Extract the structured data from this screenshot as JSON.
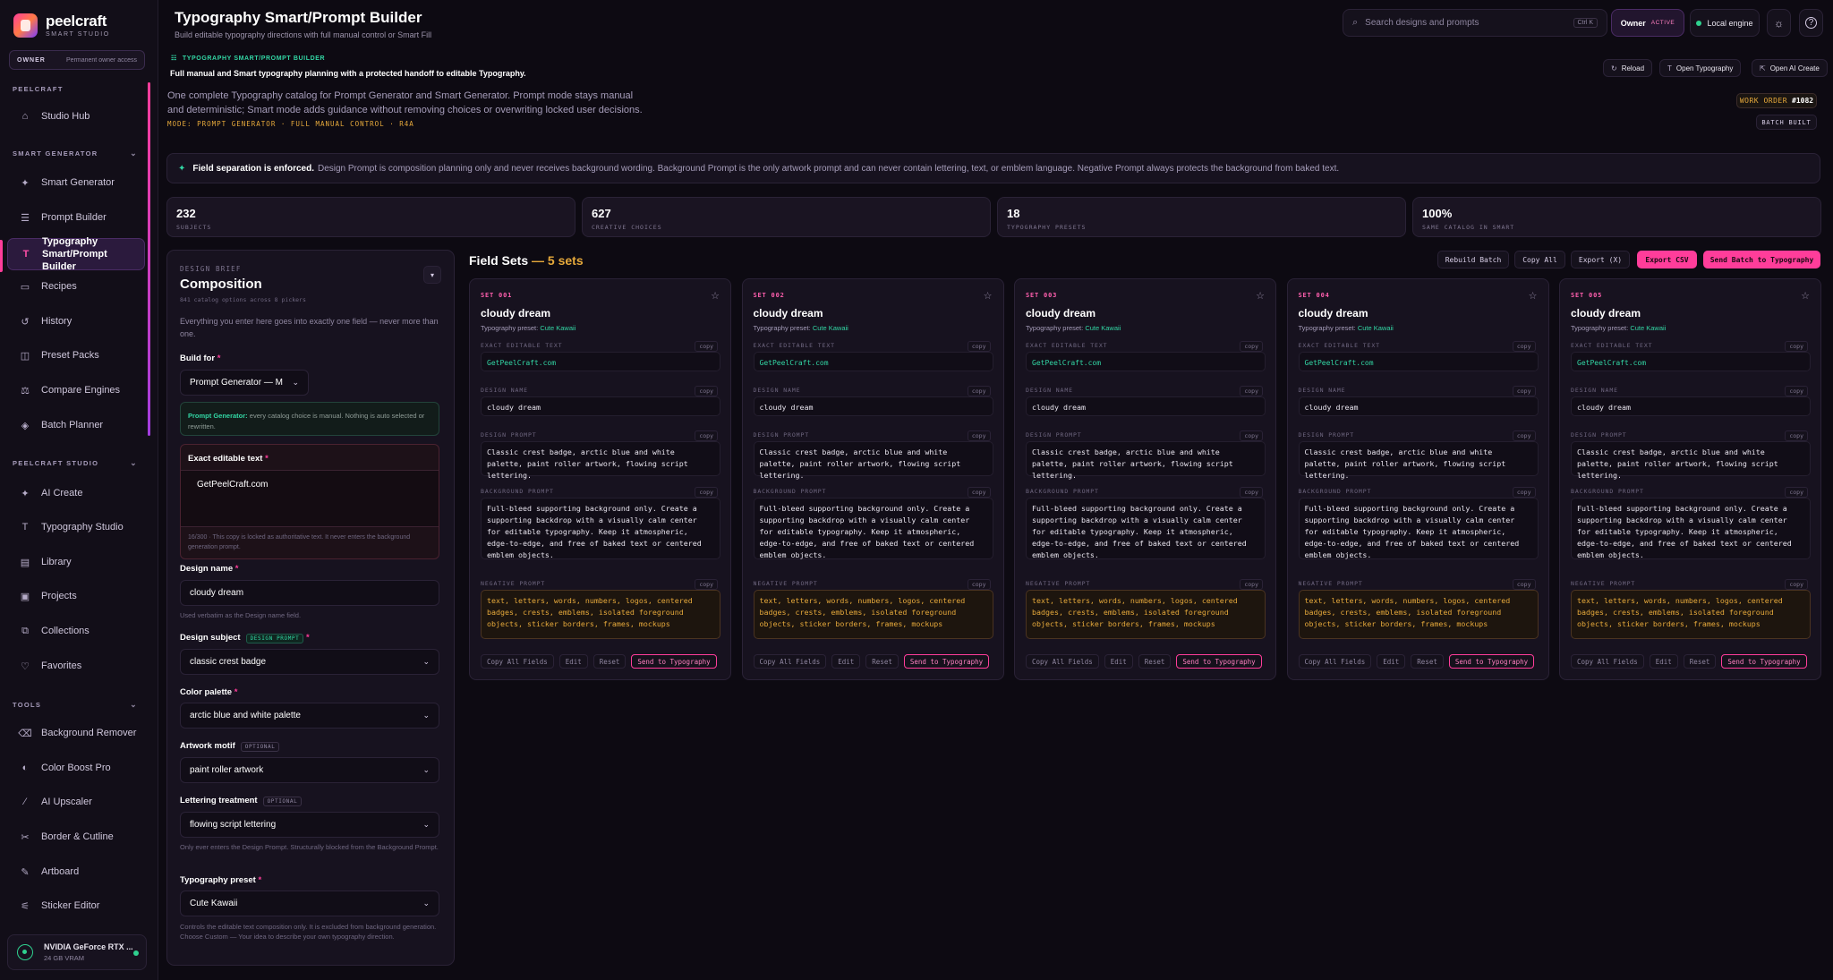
{
  "brand": {
    "name": "peelcraft",
    "sub": "SMART STUDIO"
  },
  "owner_pill": {
    "label": "OWNER",
    "value": "Permanent owner access"
  },
  "sidebar": {
    "section_peelcraft": "PEELCRAFT",
    "section_smart": "SMART GENERATOR",
    "section_studio": "PEELCRAFT STUDIO",
    "section_tools": "TOOLS",
    "items": [
      {
        "label": "Studio Hub",
        "icon": "home-icon"
      },
      {
        "label": "Smart Generator",
        "icon": "sparkles-icon"
      },
      {
        "label": "Prompt Builder",
        "icon": "list-icon"
      },
      {
        "label": "Typography Smart/Prompt Builder",
        "icon": "type-icon"
      },
      {
        "label": "Recipes",
        "icon": "folder-icon"
      },
      {
        "label": "History",
        "icon": "history-icon"
      },
      {
        "label": "Preset Packs",
        "icon": "package-icon"
      },
      {
        "label": "Compare Engines",
        "icon": "scale-icon"
      },
      {
        "label": "Batch Planner",
        "icon": "layers-icon"
      },
      {
        "label": "AI Create",
        "icon": "sparkles-icon"
      },
      {
        "label": "Typography Studio",
        "icon": "type-icon"
      },
      {
        "label": "Library",
        "icon": "library-icon"
      },
      {
        "label": "Projects",
        "icon": "projects-icon"
      },
      {
        "label": "Collections",
        "icon": "collections-icon"
      },
      {
        "label": "Favorites",
        "icon": "heart-icon"
      },
      {
        "label": "Background Remover",
        "icon": "eraser-icon"
      },
      {
        "label": "Color Boost Pro",
        "icon": "palette-icon"
      },
      {
        "label": "AI Upscaler",
        "icon": "wand-icon"
      },
      {
        "label": "Border & Cutline",
        "icon": "scissors-icon"
      },
      {
        "label": "Artboard",
        "icon": "pen-icon"
      },
      {
        "label": "Sticker Editor",
        "icon": "sliders-icon"
      }
    ],
    "gpu": {
      "name": "NVIDIA GeForce RTX ...",
      "memory": "24 GB VRAM"
    }
  },
  "header": {
    "title": "Typography Smart/Prompt Builder",
    "subtitle": "Build editable typography directions with full manual control or Smart Fill",
    "search_placeholder": "Search designs and prompts",
    "search_kbd": "Ctrl K",
    "owner_label": "Owner",
    "owner_badge": "ACTIVE",
    "engine_label": "Local engine"
  },
  "hero": {
    "tag": "TYPOGRAPHY SMART/PROMPT BUILDER",
    "title": "Full manual and Smart typography planning with a protected handoff to editable Typography.",
    "description": "One complete Typography catalog for Prompt Generator and Smart Generator. Prompt mode stays manual and deterministic; Smart mode adds guidance without removing choices or overwriting locked user decisions.",
    "mode": "MODE: PROMPT GENERATOR · FULL MANUAL CONTROL · R4A",
    "actions": {
      "reload": "Reload",
      "open_typography": "Open Typography",
      "open_ai_create": "Open AI Create"
    },
    "work_order_label": "WORK ORDER",
    "work_order_value": "#1082",
    "batch_built": "BATCH BUILT"
  },
  "notice": {
    "bold": "Field separation is enforced.",
    "text": "Design Prompt is composition planning only and never receives background wording. Background Prompt is the only artwork prompt and can never contain lettering, text, or emblem language. Negative Prompt always protects the background from baked text."
  },
  "stats": [
    {
      "value": "232",
      "label": "SUBJECTS"
    },
    {
      "value": "627",
      "label": "CREATIVE CHOICES"
    },
    {
      "value": "18",
      "label": "TYPOGRAPHY PRESETS"
    },
    {
      "value": "100%",
      "label": "SAME CATALOG IN SMART"
    }
  ],
  "brief": {
    "eyebrow": "DESIGN BRIEF",
    "title": "Composition",
    "subtitle": "841 catalog options across 8 pickers",
    "collapse_glyph": "▾",
    "intro": "Everything you enter here goes into exactly one field — never more than one.",
    "build_for_label": "Build for",
    "build_for_value": "Prompt Generator — M",
    "prompt_gen_note_bold": "Prompt Generator:",
    "prompt_gen_note": "every catalog choice is manual. Nothing is auto selected or rewritten.",
    "exact_text_label": "Exact editable text",
    "exact_text_value": "GetPeelCraft.com",
    "exact_text_note": "16/300 · This copy is locked as authoritative text. It never enters the background generation prompt.",
    "design_name_label": "Design name",
    "design_name_value": "cloudy dream",
    "design_name_help": "Used verbatim as the Design name field.",
    "subject_label": "Design subject",
    "subject_badge": "DESIGN PROMPT",
    "subject_value": "classic crest badge",
    "palette_label": "Color palette",
    "palette_value": "arctic blue and white palette",
    "motif_label": "Artwork motif",
    "motif_badge": "OPTIONAL",
    "motif_value": "paint roller artwork",
    "lettering_label": "Lettering treatment",
    "lettering_badge": "OPTIONAL",
    "lettering_value": "flowing script lettering",
    "lettering_help": "Only ever enters the Design Prompt. Structurally blocked from the Background Prompt.",
    "preset_label": "Typography preset",
    "preset_value": "Cute Kawaii",
    "preset_help": "Controls the editable text composition only. It is excluded from background generation. Choose Custom — Your idea to describe your own typography direction."
  },
  "field_sets": {
    "title": "Field Sets",
    "count": "— 5 sets",
    "toolbar": {
      "rebuild": "Rebuild Batch",
      "copy_all": "Copy All",
      "export": "Export (X)",
      "export_csv": "Export CSV",
      "send_batch": "Send Batch to Typography"
    },
    "labels": {
      "preset": "Typography preset:",
      "exact": "EXACT EDITABLE TEXT",
      "name": "DESIGN NAME",
      "design": "DESIGN PROMPT",
      "background": "BACKGROUND PROMPT",
      "negative": "NEGATIVE PROMPT",
      "copy": "copy"
    },
    "actions": {
      "copy_all": "Copy All Fields",
      "edit": "Edit",
      "reset": "Reset",
      "send": "Send to Typography"
    },
    "sets": [
      {
        "id": "SET 001",
        "name": "cloudy dream",
        "preset": "Cute Kawaii",
        "exact": "GetPeelCraft.com",
        "design_name": "cloudy dream",
        "design_prompt": "Classic crest badge, arctic blue and white palette, paint roller artwork, flowing script lettering.",
        "background_prompt": "Full-bleed supporting background only. Create a supporting backdrop with a visually calm center for editable typography. Keep it atmospheric, edge-to-edge, and free of baked text or centered emblem objects.",
        "negative_prompt": "text, letters, words, numbers, logos, centered badges, crests, emblems, isolated foreground objects, sticker borders, frames, mockups"
      },
      {
        "id": "SET 002",
        "name": "cloudy dream",
        "preset": "Cute Kawaii",
        "exact": "GetPeelCraft.com",
        "design_name": "cloudy dream",
        "design_prompt": "Classic crest badge, arctic blue and white palette, paint roller artwork, flowing script lettering.",
        "background_prompt": "Full-bleed supporting background only. Create a supporting backdrop with a visually calm center for editable typography. Keep it atmospheric, edge-to-edge, and free of baked text or centered emblem objects.",
        "negative_prompt": "text, letters, words, numbers, logos, centered badges, crests, emblems, isolated foreground objects, sticker borders, frames, mockups"
      },
      {
        "id": "SET 003",
        "name": "cloudy dream",
        "preset": "Cute Kawaii",
        "exact": "GetPeelCraft.com",
        "design_name": "cloudy dream",
        "design_prompt": "Classic crest badge, arctic blue and white palette, paint roller artwork, flowing script lettering.",
        "background_prompt": "Full-bleed supporting background only. Create a supporting backdrop with a visually calm center for editable typography. Keep it atmospheric, edge-to-edge, and free of baked text or centered emblem objects.",
        "negative_prompt": "text, letters, words, numbers, logos, centered badges, crests, emblems, isolated foreground objects, sticker borders, frames, mockups"
      },
      {
        "id": "SET 004",
        "name": "cloudy dream",
        "preset": "Cute Kawaii",
        "exact": "GetPeelCraft.com",
        "design_name": "cloudy dream",
        "design_prompt": "Classic crest badge, arctic blue and white palette, paint roller artwork, flowing script lettering.",
        "background_prompt": "Full-bleed supporting background only. Create a supporting backdrop with a visually calm center for editable typography. Keep it atmospheric, edge-to-edge, and free of baked text or centered emblem objects.",
        "negative_prompt": "text, letters, words, numbers, logos, centered badges, crests, emblems, isolated foreground objects, sticker borders, frames, mockups"
      },
      {
        "id": "SET 005",
        "name": "cloudy dream",
        "preset": "Cute Kawaii",
        "exact": "GetPeelCraft.com",
        "design_name": "cloudy dream",
        "design_prompt": "Classic crest badge, arctic blue and white palette, paint roller artwork, flowing script lettering.",
        "background_prompt": "Full-bleed supporting background only. Create a supporting backdrop with a visually calm center for editable typography. Keep it atmospheric, edge-to-edge, and free of baked text or centered emblem objects.",
        "negative_prompt": "text, letters, words, numbers, logos, centered badges, crests, emblems, isolated foreground objects, sticker borders, frames, mockups"
      }
    ]
  },
  "colors": {
    "accent": "#ff3d9a",
    "teal": "#32d6a4",
    "amber": "#e6a93b",
    "bg": "#0d0a12"
  }
}
